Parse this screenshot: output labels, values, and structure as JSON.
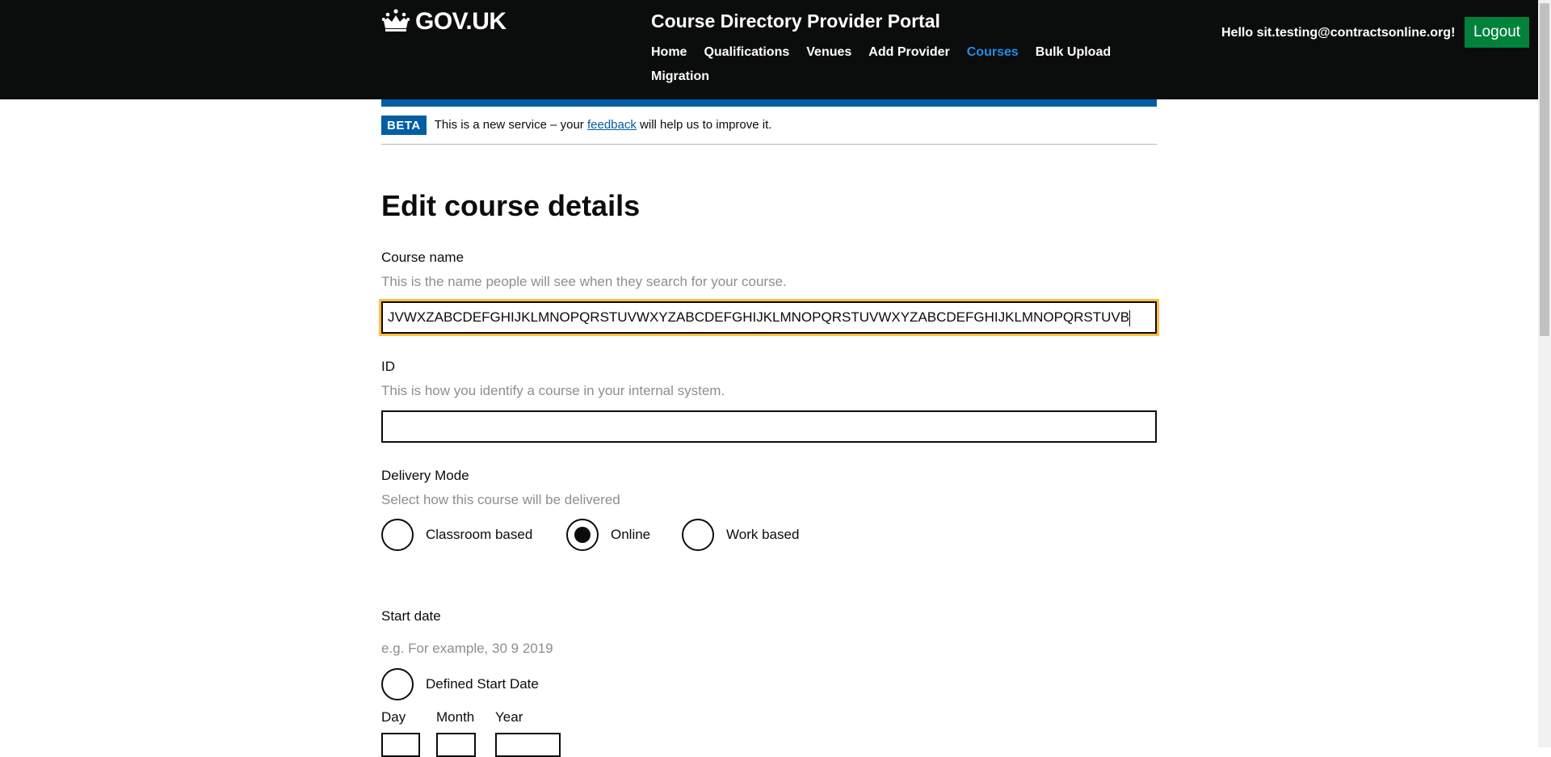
{
  "header": {
    "logo_text": "GOV.UK",
    "service_name": "Course Directory Provider Portal",
    "nav": [
      {
        "label": "Home",
        "active": false
      },
      {
        "label": "Qualifications",
        "active": false
      },
      {
        "label": "Venues",
        "active": false
      },
      {
        "label": "Add Provider",
        "active": false
      },
      {
        "label": "Courses",
        "active": true
      },
      {
        "label": "Bulk Upload",
        "active": false
      },
      {
        "label": "Migration",
        "active": false
      }
    ],
    "greeting": "Hello sit.testing@contractsonline.org!",
    "logout_label": "Logout"
  },
  "phase": {
    "tag": "BETA",
    "text_before": "This is a new service – your ",
    "link_text": "feedback",
    "text_after": " will help us to improve it."
  },
  "page": {
    "title": "Edit course details"
  },
  "course_name": {
    "label": "Course name",
    "hint": "This is the name people will see when they search for your course.",
    "value": "JVWXZABCDEFGHIJKLMNOPQRSTUVWXYZABCDEFGHIJKLMNOPQRSTUVWXYZABCDEFGHIJKLMNOPQRSTUVB"
  },
  "course_id": {
    "label": "ID",
    "hint": "This is how you identify a course in your internal system.",
    "value": ""
  },
  "delivery_mode": {
    "label": "Delivery Mode",
    "hint": "Select how this course will be delivered",
    "options": [
      {
        "label": "Classroom based",
        "checked": false
      },
      {
        "label": "Online",
        "checked": true
      },
      {
        "label": "Work based",
        "checked": false
      }
    ]
  },
  "start_date": {
    "label": "Start date",
    "hint": "e.g. For example, 30 9 2019",
    "defined_option": "Defined Start Date",
    "day_label": "Day",
    "month_label": "Month",
    "year_label": "Year"
  },
  "colors": {
    "header_bg": "#0b0c0c",
    "active_nav": "#1d8feb",
    "logout_bg": "#00823b",
    "beta_blue": "#005ea5",
    "focus": "#ffbf47"
  }
}
